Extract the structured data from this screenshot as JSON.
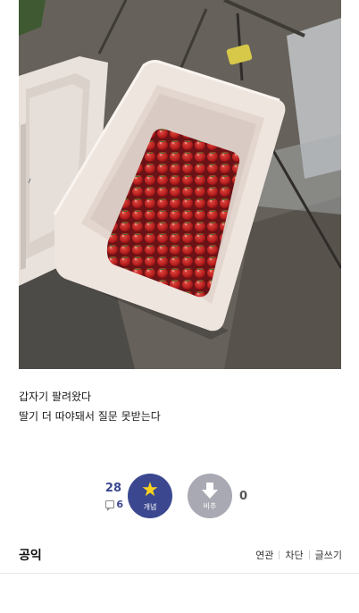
{
  "photo": {
    "icon": "photo-strawberries-in-bin"
  },
  "post": {
    "line1": "갑자기 팔려왔다",
    "line2": "딸기 더 따야돼서 질문 못받는다"
  },
  "votes": {
    "up_count": "28",
    "comment_count": "6",
    "up_label": "개념",
    "down_label": "비추",
    "down_count": "0",
    "up_color": "#3b4890",
    "down_color": "#a9a9b3",
    "star_color": "#ffd41e"
  },
  "footer": {
    "gallery_name": "공익",
    "links": [
      "연관",
      "차단",
      "글쓰기"
    ]
  }
}
